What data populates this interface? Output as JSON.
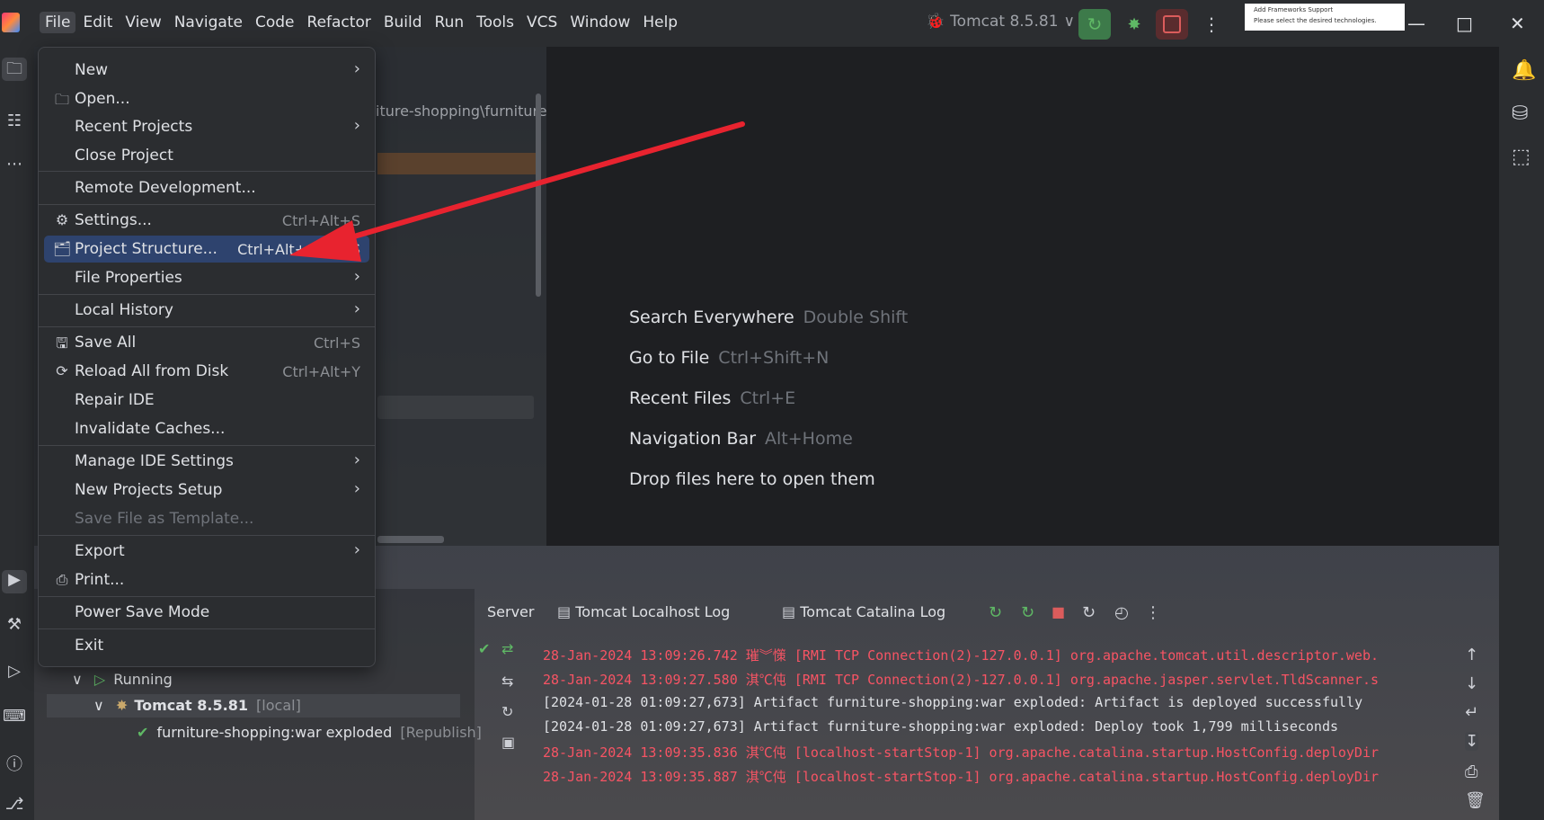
{
  "menubar": {
    "items": [
      "File",
      "Edit",
      "View",
      "Navigate",
      "Code",
      "Refactor",
      "Build",
      "Run",
      "Tools",
      "VCS",
      "Window",
      "Help"
    ]
  },
  "toolbar": {
    "run_config": "Tomcat 8.5.81",
    "thumbnail_title": "Add Frameworks Support",
    "thumbnail_text": "Please select the desired technologies."
  },
  "file_menu": {
    "items": [
      {
        "label": "New",
        "shortcut": "",
        "submenu": true,
        "icon": ""
      },
      {
        "label": "Open...",
        "shortcut": "",
        "submenu": false,
        "icon": "folder-icon"
      },
      {
        "label": "Recent Projects",
        "shortcut": "",
        "submenu": true,
        "icon": ""
      },
      {
        "label": "Close Project",
        "shortcut": "",
        "submenu": false,
        "icon": ""
      },
      {
        "label": "Remote Development...",
        "shortcut": "",
        "submenu": false,
        "icon": ""
      },
      {
        "label": "Settings...",
        "shortcut": "Ctrl+Alt+S",
        "submenu": false,
        "icon": "gear-icon"
      },
      {
        "label": "Project Structure...",
        "shortcut": "Ctrl+Alt+Shift+S",
        "submenu": false,
        "icon": "project-structure-icon",
        "selected": true
      },
      {
        "label": "File Properties",
        "shortcut": "",
        "submenu": true,
        "icon": ""
      },
      {
        "label": "Local History",
        "shortcut": "",
        "submenu": true,
        "icon": ""
      },
      {
        "label": "Save All",
        "shortcut": "Ctrl+S",
        "submenu": false,
        "icon": "save-icon"
      },
      {
        "label": "Reload All from Disk",
        "shortcut": "Ctrl+Alt+Y",
        "submenu": false,
        "icon": "reload-icon"
      },
      {
        "label": "Repair IDE",
        "shortcut": "",
        "submenu": false,
        "icon": ""
      },
      {
        "label": "Invalidate Caches...",
        "shortcut": "",
        "submenu": false,
        "icon": ""
      },
      {
        "label": "Manage IDE Settings",
        "shortcut": "",
        "submenu": true,
        "icon": ""
      },
      {
        "label": "New Projects Setup",
        "shortcut": "",
        "submenu": true,
        "icon": ""
      },
      {
        "label": "Save File as Template...",
        "shortcut": "",
        "submenu": false,
        "icon": "",
        "disabled": true
      },
      {
        "label": "Export",
        "shortcut": "",
        "submenu": true,
        "icon": ""
      },
      {
        "label": "Print...",
        "shortcut": "",
        "submenu": false,
        "icon": "print-icon"
      },
      {
        "label": "Power Save Mode",
        "shortcut": "",
        "submenu": false,
        "icon": ""
      },
      {
        "label": "Exit",
        "shortcut": "",
        "submenu": false,
        "icon": ""
      }
    ]
  },
  "project_panel": {
    "path_fragment": "iture-shopping\\furniture"
  },
  "welcome": {
    "hints": [
      {
        "action": "Search Everywhere",
        "key": "Double Shift"
      },
      {
        "action": "Go to File",
        "key": "Ctrl+Shift+N"
      },
      {
        "action": "Recent Files",
        "key": "Ctrl+E"
      },
      {
        "action": "Navigation Bar",
        "key": "Alt+Home"
      },
      {
        "action": "Drop files here to open them",
        "key": ""
      }
    ]
  },
  "services": {
    "running_label": "Running",
    "server_name": "Tomcat 8.5.81",
    "server_tag": "[local]",
    "artifact_name": "furniture-shopping:war exploded",
    "artifact_tag": "[Republish]",
    "tabs": [
      "Server",
      "Tomcat Localhost Log",
      "Tomcat Catalina Log"
    ],
    "log_lines": [
      {
        "text": "28-Jan-2024 13:09:26.742 璀︾憡 [RMI TCP Connection(2)-127.0.0.1] org.apache.tomcat.util.descriptor.web.",
        "level": "err"
      },
      {
        "text": "28-Jan-2024 13:09:27.580 淇℃伅 [RMI TCP Connection(2)-127.0.0.1] org.apache.jasper.servlet.TldScanner.s",
        "level": "err"
      },
      {
        "text": "[2024-01-28 01:09:27,673] Artifact furniture-shopping:war exploded: Artifact is deployed successfully",
        "level": "info"
      },
      {
        "text": "[2024-01-28 01:09:27,673] Artifact furniture-shopping:war exploded: Deploy took 1,799 milliseconds",
        "level": "info"
      },
      {
        "text": "28-Jan-2024 13:09:35.836 淇℃伅 [localhost-startStop-1] org.apache.catalina.startup.HostConfig.deployDir",
        "level": "err"
      },
      {
        "text": "28-Jan-2024 13:09:35.887 淇℃伅 [localhost-startStop-1] org.apache.catalina.startup.HostConfig.deployDir",
        "level": "err"
      }
    ]
  },
  "colors": {
    "menu_bg": "#2b2d30",
    "selection": "#2e436e",
    "error_log": "#f75464",
    "arrow": "#e8232f"
  }
}
